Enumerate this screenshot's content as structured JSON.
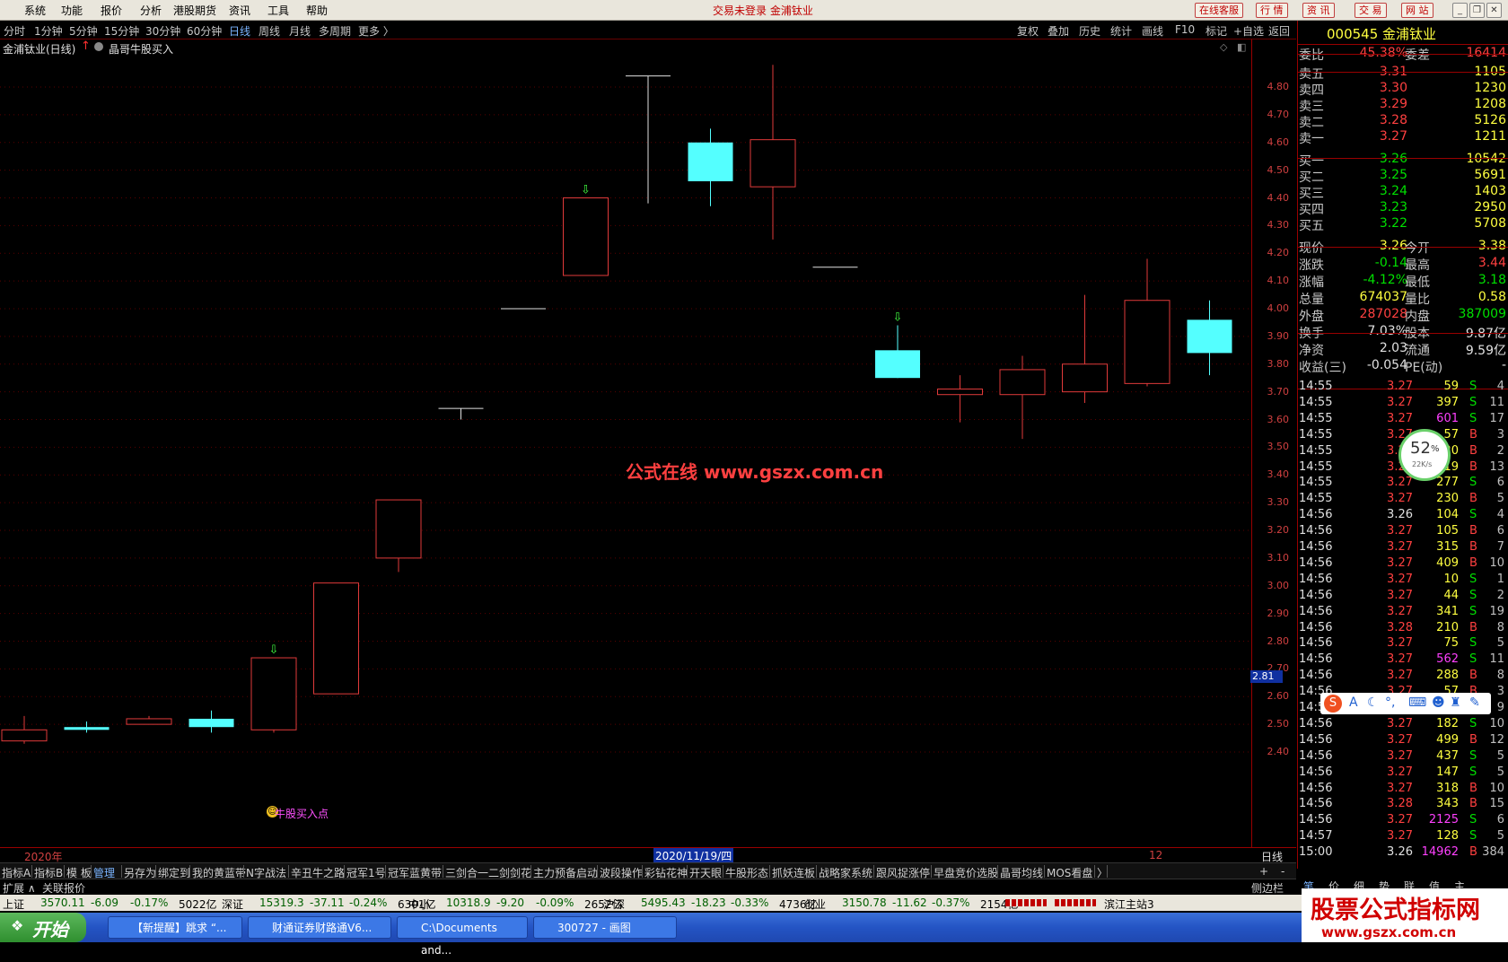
{
  "menu": {
    "items": [
      "系统",
      "功能",
      "报价",
      "分析",
      "港股期货",
      "资讯",
      "工具",
      "帮助"
    ],
    "title": "交易未登录  金浦钛业",
    "buttons": [
      "在线客服",
      "行 情",
      "资 讯",
      "交 易",
      "网 站"
    ]
  },
  "periods": {
    "items": [
      "分时",
      "1分钟",
      "5分钟",
      "15分钟",
      "30分钟",
      "60分钟",
      "日线",
      "周线",
      "月线",
      "多周期",
      "更多 〉"
    ],
    "active": "日线"
  },
  "toolbar": {
    "items": [
      "复权",
      "叠加",
      "历史",
      "统计",
      "画线",
      "F10",
      "标记",
      "+自选",
      "返回"
    ]
  },
  "chart": {
    "header": "金浦钛业(日线)",
    "indicator": "晶哥牛股买入",
    "watermark": "公式在线  www.gszx.com.cn",
    "buy_label": "牛股买入点",
    "cursor_price": "2.81",
    "date_left": "2020年",
    "date_cursor": "2020/11/19/四",
    "date_right": "12",
    "period_label": "日线"
  },
  "chart_data": {
    "type": "candlestick",
    "y_ticks": [
      "4.80",
      "4.70",
      "4.60",
      "4.50",
      "4.40",
      "4.30",
      "4.20",
      "4.10",
      "4.00",
      "3.90",
      "3.80",
      "3.70",
      "3.60",
      "3.50",
      "3.40",
      "3.30",
      "3.20",
      "3.10",
      "3.00",
      "2.90",
      "2.80",
      "2.70",
      "2.60",
      "2.50",
      "2.40"
    ],
    "ylim": [
      2.34,
      4.9
    ],
    "candles": [
      {
        "o": 2.44,
        "c": 2.48,
        "h": 2.53,
        "l": 2.43,
        "color": "red"
      },
      {
        "o": 2.49,
        "c": 2.48,
        "h": 2.51,
        "l": 2.47,
        "color": "cyan"
      },
      {
        "o": 2.5,
        "c": 2.52,
        "h": 2.53,
        "l": 2.5,
        "color": "red"
      },
      {
        "o": 2.52,
        "c": 2.49,
        "h": 2.55,
        "l": 2.47,
        "color": "cyan"
      },
      {
        "o": 2.48,
        "c": 2.74,
        "h": 2.74,
        "l": 2.47,
        "color": "red",
        "signal": true
      },
      {
        "o": 2.61,
        "c": 3.01,
        "h": 3.01,
        "l": 2.61,
        "color": "red"
      },
      {
        "o": 3.1,
        "c": 3.31,
        "h": 3.31,
        "l": 3.05,
        "color": "red"
      },
      {
        "o": 3.64,
        "c": 3.64,
        "h": 3.64,
        "l": 3.6,
        "color": "white"
      },
      {
        "o": 4.0,
        "c": 4.0,
        "h": 4.0,
        "l": 4.0,
        "color": "white"
      },
      {
        "o": 4.12,
        "c": 4.4,
        "h": 4.4,
        "l": 4.12,
        "color": "red",
        "signal": true
      },
      {
        "o": 4.84,
        "c": 4.84,
        "h": 4.84,
        "l": 4.38,
        "color": "white"
      },
      {
        "o": 4.6,
        "c": 4.46,
        "h": 4.65,
        "l": 4.37,
        "color": "cyan"
      },
      {
        "o": 4.44,
        "c": 4.61,
        "h": 4.88,
        "l": 4.25,
        "color": "red"
      },
      {
        "o": 4.15,
        "c": 4.15,
        "h": 4.15,
        "l": 4.15,
        "color": "white"
      },
      {
        "o": 3.85,
        "c": 3.75,
        "h": 3.94,
        "l": 3.75,
        "color": "cyan",
        "signal": true
      },
      {
        "o": 3.69,
        "c": 3.71,
        "h": 3.76,
        "l": 3.59,
        "color": "red"
      },
      {
        "o": 3.69,
        "c": 3.78,
        "h": 3.83,
        "l": 3.53,
        "color": "red"
      },
      {
        "o": 3.7,
        "c": 3.8,
        "h": 4.05,
        "l": 3.66,
        "color": "red"
      },
      {
        "o": 3.73,
        "c": 4.03,
        "h": 4.18,
        "l": 3.72,
        "color": "red"
      },
      {
        "o": 3.96,
        "c": 3.84,
        "h": 4.03,
        "l": 3.76,
        "color": "cyan"
      }
    ]
  },
  "quote": {
    "code_name": "000545 金浦钛业",
    "weibi": {
      "label": "委比",
      "value": "45.38%",
      "label2": "委差",
      "value2": "16414"
    },
    "asks": [
      {
        "label": "卖五",
        "price": "3.31",
        "vol": "1105"
      },
      {
        "label": "卖四",
        "price": "3.30",
        "vol": "1230"
      },
      {
        "label": "卖三",
        "price": "3.29",
        "vol": "1208"
      },
      {
        "label": "卖二",
        "price": "3.28",
        "vol": "5126"
      },
      {
        "label": "卖一",
        "price": "3.27",
        "vol": "1211"
      }
    ],
    "bids": [
      {
        "label": "买一",
        "price": "3.26",
        "vol": "10542"
      },
      {
        "label": "买二",
        "price": "3.25",
        "vol": "5691"
      },
      {
        "label": "买三",
        "price": "3.24",
        "vol": "1403"
      },
      {
        "label": "买四",
        "price": "3.23",
        "vol": "2950"
      },
      {
        "label": "买五",
        "price": "3.22",
        "vol": "5708"
      }
    ],
    "stats": [
      {
        "l": "现价",
        "v": "3.26",
        "vc": "yellow",
        "l2": "今开",
        "v2": "3.38",
        "v2c": "yellow"
      },
      {
        "l": "涨跌",
        "v": "-0.14",
        "vc": "green",
        "l2": "最高",
        "v2": "3.44",
        "v2c": "red"
      },
      {
        "l": "涨幅",
        "v": "-4.12%",
        "vc": "green",
        "l2": "最低",
        "v2": "3.18",
        "v2c": "green"
      },
      {
        "l": "总量",
        "v": "674037",
        "vc": "yellow",
        "l2": "量比",
        "v2": "0.58",
        "v2c": "yellow"
      },
      {
        "l": "外盘",
        "v": "287028",
        "vc": "red",
        "l2": "内盘",
        "v2": "387009",
        "v2c": "green"
      },
      {
        "l": "换手",
        "v": "7.03%",
        "vc": "white",
        "l2": "股本",
        "v2": "9.87亿",
        "v2c": "white"
      },
      {
        "l": "净资",
        "v": "2.03",
        "vc": "white",
        "l2": "流通",
        "v2": "9.59亿",
        "v2c": "white"
      },
      {
        "l": "收益(三)",
        "v": "-0.054",
        "vc": "white",
        "l2": "PE(动)",
        "v2": "-",
        "v2c": "white"
      }
    ],
    "ticks": [
      {
        "t": "14:55",
        "p": "3.27",
        "v": "59",
        "bs": "S",
        "n": "4"
      },
      {
        "t": "14:55",
        "p": "3.27",
        "v": "397",
        "bs": "S",
        "n": "11"
      },
      {
        "t": "14:55",
        "p": "3.27",
        "v": "601",
        "bs": "S",
        "n": "17"
      },
      {
        "t": "14:55",
        "p": "3.27",
        "v": "57",
        "bs": "B",
        "n": "3"
      },
      {
        "t": "14:55",
        "p": "3.27",
        "v": "20",
        "bs": "B",
        "n": "2"
      },
      {
        "t": "14:55",
        "p": "3.27",
        "v": "19",
        "bs": "B",
        "n": "13"
      },
      {
        "t": "14:55",
        "p": "3.27",
        "v": "277",
        "bs": "S",
        "n": "6"
      },
      {
        "t": "14:55",
        "p": "3.27",
        "v": "230",
        "bs": "B",
        "n": "5"
      },
      {
        "t": "14:56",
        "p": "3.26",
        "v": "104",
        "bs": "S",
        "n": "4"
      },
      {
        "t": "14:56",
        "p": "3.27",
        "v": "105",
        "bs": "B",
        "n": "6"
      },
      {
        "t": "14:56",
        "p": "3.27",
        "v": "315",
        "bs": "B",
        "n": "7"
      },
      {
        "t": "14:56",
        "p": "3.27",
        "v": "409",
        "bs": "B",
        "n": "10"
      },
      {
        "t": "14:56",
        "p": "3.27",
        "v": "10",
        "bs": "S",
        "n": "1"
      },
      {
        "t": "14:56",
        "p": "3.27",
        "v": "44",
        "bs": "S",
        "n": "2"
      },
      {
        "t": "14:56",
        "p": "3.27",
        "v": "341",
        "bs": "S",
        "n": "19"
      },
      {
        "t": "14:56",
        "p": "3.28",
        "v": "210",
        "bs": "B",
        "n": "8"
      },
      {
        "t": "14:56",
        "p": "3.27",
        "v": "75",
        "bs": "S",
        "n": "5"
      },
      {
        "t": "14:56",
        "p": "3.27",
        "v": "562",
        "bs": "S",
        "n": "11"
      },
      {
        "t": "14:56",
        "p": "3.27",
        "v": "288",
        "bs": "B",
        "n": "8"
      },
      {
        "t": "14:56",
        "p": "3.27",
        "v": "57",
        "bs": "B",
        "n": "3"
      },
      {
        "t": "14:56",
        "p": "3.27",
        "v": "20",
        "bs": "B",
        "n": "9"
      },
      {
        "t": "14:56",
        "p": "3.27",
        "v": "182",
        "bs": "S",
        "n": "10"
      },
      {
        "t": "14:56",
        "p": "3.27",
        "v": "499",
        "bs": "B",
        "n": "12"
      },
      {
        "t": "14:56",
        "p": "3.27",
        "v": "437",
        "bs": "S",
        "n": "5"
      },
      {
        "t": "14:56",
        "p": "3.27",
        "v": "147",
        "bs": "S",
        "n": "5"
      },
      {
        "t": "14:56",
        "p": "3.27",
        "v": "318",
        "bs": "B",
        "n": "10"
      },
      {
        "t": "14:56",
        "p": "3.28",
        "v": "343",
        "bs": "B",
        "n": "15"
      },
      {
        "t": "14:56",
        "p": "3.27",
        "v": "2125",
        "bs": "S",
        "n": "6"
      },
      {
        "t": "14:57",
        "p": "3.27",
        "v": "128",
        "bs": "S",
        "n": "5"
      },
      {
        "t": "15:00",
        "p": "3.26",
        "v": "14962",
        "bs": "B",
        "n": "384"
      }
    ],
    "bottom_tabs": [
      "笔",
      "价",
      "细",
      "势",
      "联",
      "值",
      "主"
    ]
  },
  "tabs": {
    "items": [
      "指标A",
      "指标B",
      "模 板",
      "管理",
      "另存为",
      "绑定到",
      "我的黄蓝带",
      "N字战法",
      "辛丑牛之路",
      "冠军1号",
      "冠军蓝黄带",
      "三剑合一二剑剑花",
      "主力预备启动",
      "波段操作",
      "彩钻花神",
      "开天眼",
      "牛股形态",
      "抓妖连板",
      "战略家系统",
      "跟风捉涨停",
      "早盘竞价选股",
      "晶哥均线",
      "MOS看盘",
      "〉"
    ],
    "active": "管理",
    "right": [
      "+",
      "-"
    ]
  },
  "ext": {
    "items": [
      "扩展 ∧",
      "关联报价"
    ],
    "side": "侧边栏 《"
  },
  "status": {
    "items": [
      {
        "name": "上证",
        "val": "3570.11",
        "chg": "-6.09",
        "pct": "-0.17%",
        "amt": "5022亿"
      },
      {
        "name": "深证",
        "val": "15319.3",
        "chg": "-37.11",
        "pct": "-0.24%",
        "amt": "6301亿"
      },
      {
        "name": "中小",
        "val": "10318.9",
        "chg": "-9.20",
        "pct": "-0.09%",
        "amt": "2652亿"
      },
      {
        "name": "沪深",
        "val": "5495.43",
        "chg": "-18.23",
        "pct": "-0.33%",
        "amt": "4736亿"
      },
      {
        "name": "创业",
        "val": "3150.78",
        "chg": "-11.62",
        "pct": "-0.37%",
        "amt": "2154亿"
      }
    ],
    "server": "滨江主站3"
  },
  "taskbar": {
    "start": "开始",
    "tasks": [
      "【新提醒】跳求 “...",
      "财通证券财路通V6...",
      "C:\\Documents and...",
      "300727 - 画图"
    ]
  },
  "speed": {
    "pct": "52",
    "unit": "%",
    "rate": "22K/s"
  },
  "logo": {
    "text": "股票公式指标网",
    "url": "www.gszx.com.cn"
  }
}
